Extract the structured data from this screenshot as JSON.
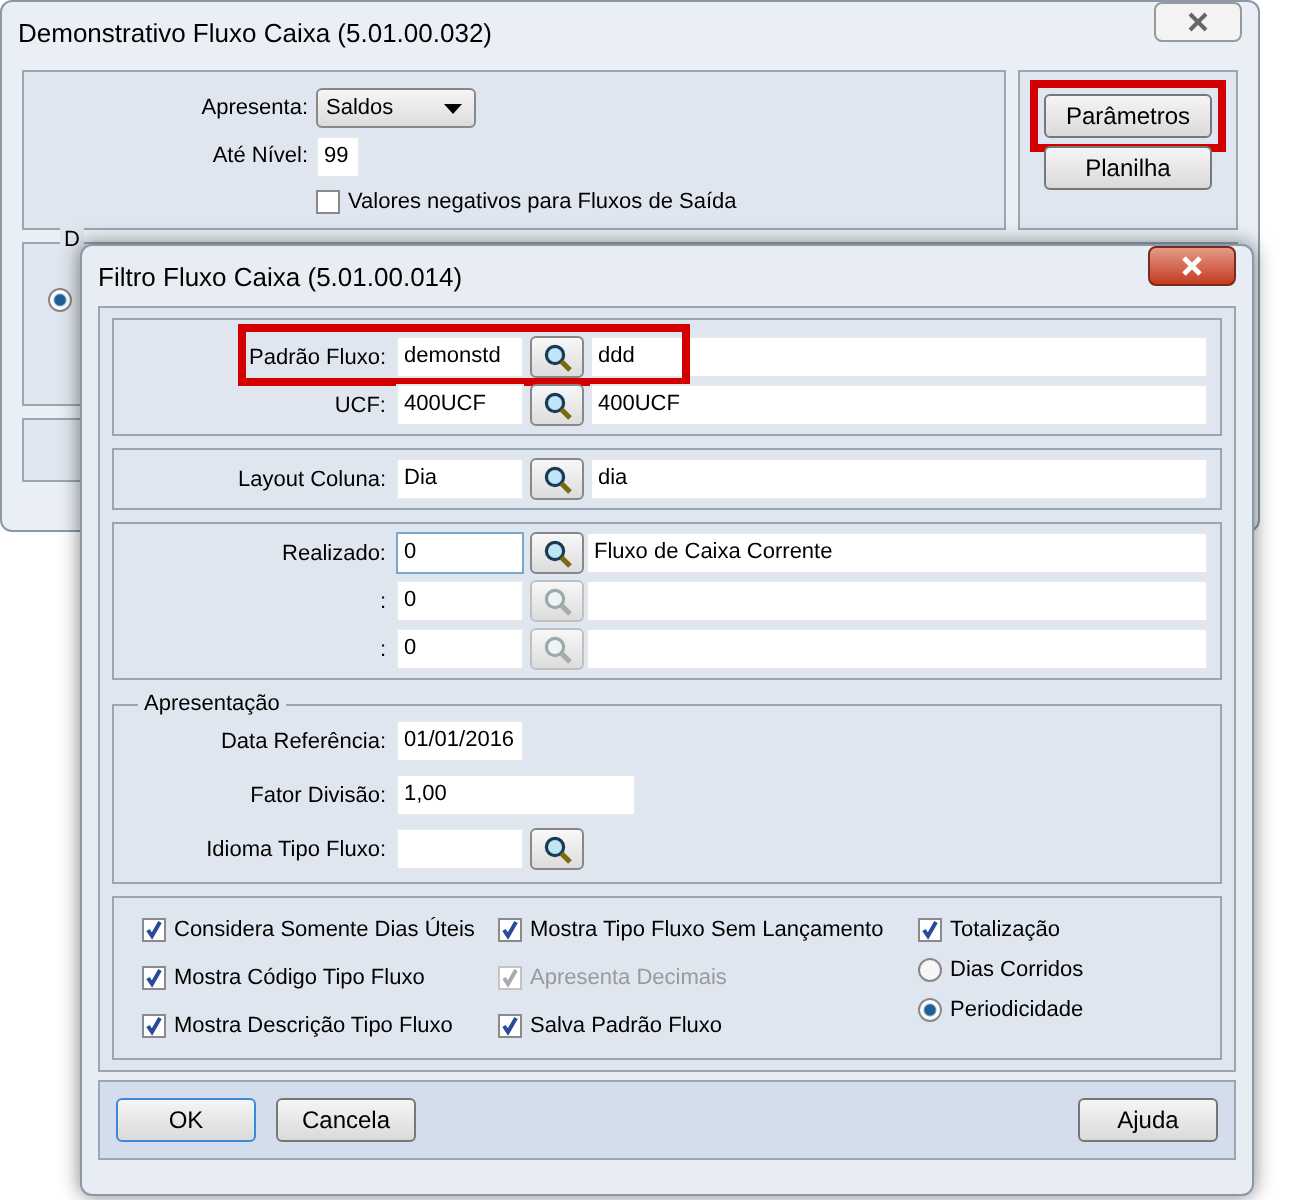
{
  "main_window": {
    "title": "Demonstrativo Fluxo Caixa (5.01.00.032)",
    "apresenta": {
      "label": "Apresenta:",
      "value": "Saldos"
    },
    "ate_nivel": {
      "label": "Até Nível:",
      "value": "99"
    },
    "negative_values": {
      "label": "Valores negativos para Fluxos de Saída",
      "checked": false
    },
    "buttons": [
      {
        "label": "Parâmetros",
        "highlighted": true
      },
      {
        "label": "Planilha",
        "highlighted": false
      }
    ],
    "group_legend": "D",
    "radio": {
      "selected": true
    }
  },
  "dialog": {
    "title": "Filtro Fluxo Caixa (5.01.00.014)",
    "lookup_rows": [
      {
        "label": "Padrão Fluxo:",
        "code": "demonstd",
        "description": "ddd",
        "highlighted": true
      },
      {
        "label": "UCF:",
        "code": "400UCF",
        "description": "400UCF",
        "highlighted": false
      }
    ],
    "layout_row": {
      "label": "Layout Coluna:",
      "code": "Dia",
      "description": "dia"
    },
    "realizado_rows": [
      {
        "label": "Realizado:",
        "code": "0",
        "description": "Fluxo de Caixa Corrente",
        "disabled": false
      },
      {
        "label": ":",
        "code": "0",
        "disabled": true
      },
      {
        "label": ":",
        "code": "0",
        "disabled": true
      }
    ],
    "apresentacao": {
      "legend": "Apresentação",
      "fields": [
        {
          "kind": "short",
          "label": "Data Referência:",
          "value": "01/01/2016"
        },
        {
          "kind": "wide",
          "label": "Fator Divisão:",
          "value": "1,00"
        },
        {
          "kind": "lookup",
          "label": "Idioma Tipo Fluxo:"
        }
      ]
    },
    "option_columns": [
      [
        {
          "kind": "checkbox",
          "label": "Considera Somente Dias Úteis",
          "checked": true,
          "disabled": false
        },
        {
          "kind": "checkbox",
          "label": "Mostra Código Tipo Fluxo",
          "checked": true,
          "disabled": false
        },
        {
          "kind": "checkbox",
          "label": "Mostra Descrição Tipo Fluxo",
          "checked": true,
          "disabled": false
        }
      ],
      [
        {
          "kind": "checkbox",
          "label": "Mostra Tipo Fluxo Sem Lançamento",
          "checked": true,
          "disabled": false
        },
        {
          "kind": "checkbox",
          "label": "Apresenta Decimais",
          "checked": true,
          "disabled": true
        },
        {
          "kind": "checkbox",
          "label": "Salva Padrão Fluxo",
          "checked": true,
          "disabled": false
        }
      ],
      [
        {
          "kind": "checkbox",
          "label": "Totalização",
          "checked": true,
          "disabled": false
        },
        {
          "kind": "radio",
          "label": "Dias Corridos",
          "selected": false
        },
        {
          "kind": "radio",
          "label": "Periodicidade",
          "selected": true
        }
      ]
    ],
    "buttons": [
      {
        "label": "OK",
        "default": true
      },
      {
        "label": "Cancela",
        "default": false
      }
    ],
    "help_button": "Ajuda"
  }
}
